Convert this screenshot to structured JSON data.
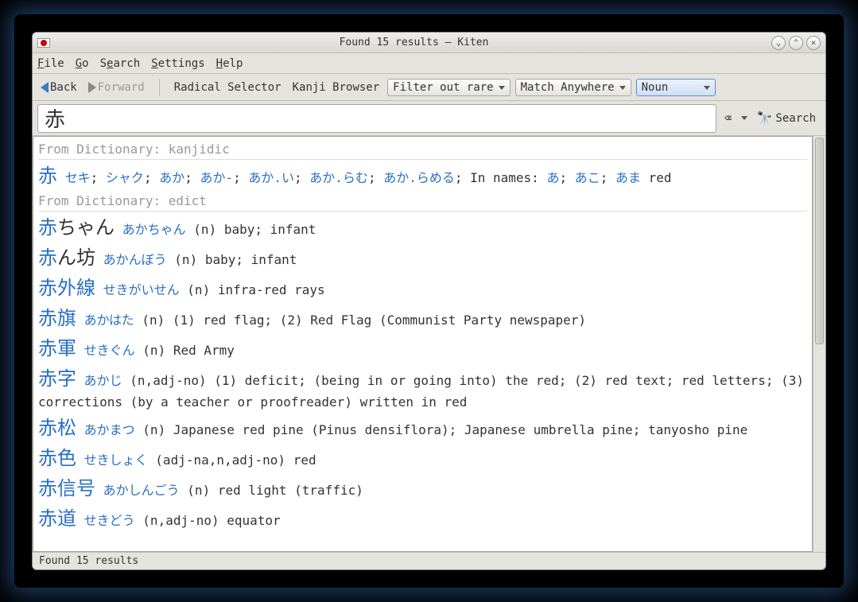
{
  "window": {
    "title": "Found 15 results – Kiten"
  },
  "menu": {
    "file": "File",
    "go": "Go",
    "search": "Search",
    "settings": "Settings",
    "help": "Help"
  },
  "toolbar": {
    "back": "Back",
    "forward": "Forward",
    "radical_selector": "Radical Selector",
    "kanji_browser": "Kanji Browser",
    "filter": "Filter out rare",
    "match": "Match Anywhere",
    "wordtype": "Noun"
  },
  "search": {
    "value": "赤",
    "button": "Search"
  },
  "dict1": {
    "header": "From Dictionary: kanjidic",
    "entry": {
      "kanji": "赤",
      "readings": [
        "セキ",
        "シャク",
        "あか",
        "あか-",
        "あか.い",
        "あか.らむ",
        "あか.らめる"
      ],
      "names_prefix": "In names:",
      "name_readings": [
        "あ",
        "あこ",
        "あま"
      ],
      "def": "red"
    }
  },
  "dict2": {
    "header": "From Dictionary: edict",
    "entries": [
      {
        "kanji_red": "赤",
        "kanji_black": "ちゃん",
        "reading": "あかちゃん",
        "def": "(n) baby; infant"
      },
      {
        "kanji_red": "赤",
        "kanji_black": "ん坊",
        "reading": "あかんぼう",
        "def": "(n) baby; infant"
      },
      {
        "kanji_red": "赤外線",
        "kanji_black": "",
        "reading": "せきがいせん",
        "def": "(n) infra-red rays"
      },
      {
        "kanji_red": "赤旗",
        "kanji_black": "",
        "reading": "あかはた",
        "def": "(n) (1) red flag; (2) Red Flag (Communist Party newspaper)"
      },
      {
        "kanji_red": "赤軍",
        "kanji_black": "",
        "reading": "せきぐん",
        "def": "(n) Red Army"
      },
      {
        "kanji_red": "赤字",
        "kanji_black": "",
        "reading": "あかじ",
        "def": "(n,adj-no) (1) deficit; (being in or going into) the red; (2) red text; red letters; (3) corrections (by a teacher or proofreader) written in red"
      },
      {
        "kanji_red": "赤松",
        "kanji_black": "",
        "reading": "あかまつ",
        "def": "(n) Japanese red pine (Pinus densiflora); Japanese umbrella pine; tanyosho pine"
      },
      {
        "kanji_red": "赤色",
        "kanji_black": "",
        "reading": "せきしょく",
        "def": "(adj-na,n,adj-no) red"
      },
      {
        "kanji_red": "赤信号",
        "kanji_black": "",
        "reading": "あかしんごう",
        "def": "(n) red light (traffic)"
      },
      {
        "kanji_red": "赤道",
        "kanji_black": "",
        "reading": "せきどう",
        "def": "(n,adj-no) equator"
      }
    ]
  },
  "status": "Found 15 results"
}
